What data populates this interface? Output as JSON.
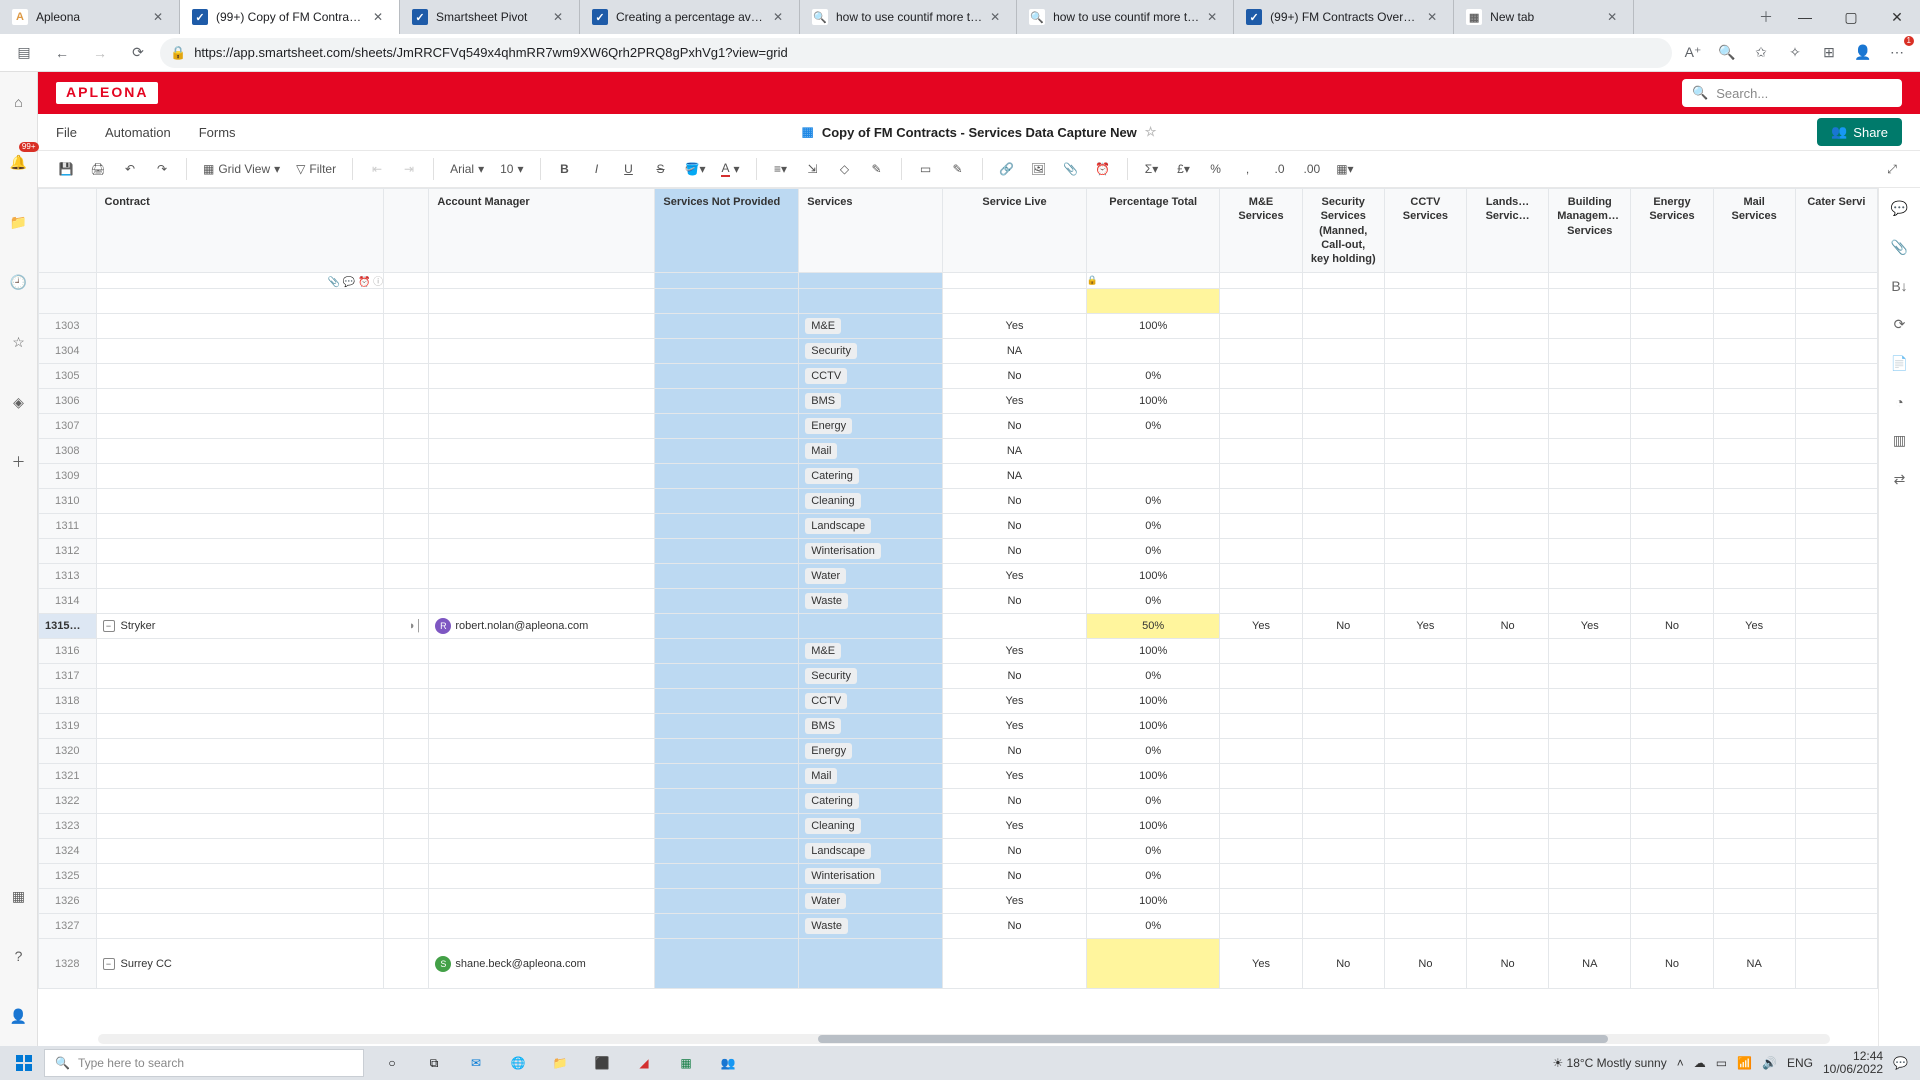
{
  "browser": {
    "tabs": [
      {
        "icon": "A",
        "iconbg": "#fff",
        "iconcolor": "#d94",
        "title": "Apleona",
        "active": false
      },
      {
        "icon": "✓",
        "iconbg": "#1e5ba8",
        "iconcolor": "#fff",
        "title": "(99+) Copy of FM Contract…",
        "active": true
      },
      {
        "icon": "✓",
        "iconbg": "#1e5ba8",
        "iconcolor": "#fff",
        "title": "Smartsheet Pivot",
        "active": false
      },
      {
        "icon": "✓",
        "iconbg": "#1e5ba8",
        "iconcolor": "#fff",
        "title": "Creating a percentage ave…",
        "active": false
      },
      {
        "icon": "🔍",
        "iconbg": "#fff",
        "iconcolor": "#666",
        "title": "how to use countif more t…",
        "active": false
      },
      {
        "icon": "🔍",
        "iconbg": "#fff",
        "iconcolor": "#666",
        "title": "how to use countif more t…",
        "active": false
      },
      {
        "icon": "✓",
        "iconbg": "#1e5ba8",
        "iconcolor": "#fff",
        "title": "(99+) FM Contracts Overv…",
        "active": false
      },
      {
        "icon": "▦",
        "iconbg": "#fff",
        "iconcolor": "#666",
        "title": "New tab",
        "active": false
      }
    ],
    "url": "https://app.smartsheet.com/sheets/JmRRCFVq549x4qhmRR7wm9XW6Qrh2PRQ8gPxhVg1?view=grid"
  },
  "app": {
    "logo": "APLEONA",
    "search_placeholder": "Search...",
    "menu": [
      "File",
      "Automation",
      "Forms"
    ],
    "doc_title": "Copy of FM Contracts - Services Data Capture New",
    "share_label": "Share",
    "toolbar": {
      "view": "Grid View",
      "filter": "Filter",
      "font": "Arial",
      "size": "10"
    }
  },
  "columns": [
    "Contract",
    "",
    "Account Manager",
    "Services Not Provided",
    "Services",
    "Service Live",
    "Percentage Total",
    "M&E Services",
    "Security Services (Manned, Call-out, key holding)",
    "CCTV Services",
    "Lands… Servic…",
    "Building Management Services",
    "Energy Services",
    "Mail Services",
    "Cater Servi"
  ],
  "rows": [
    {
      "n": 1303,
      "svc": "M&E",
      "live": "Yes",
      "pct": "100%"
    },
    {
      "n": 1304,
      "svc": "Security",
      "live": "NA",
      "pct": ""
    },
    {
      "n": 1305,
      "svc": "CCTV",
      "live": "No",
      "pct": "0%"
    },
    {
      "n": 1306,
      "svc": "BMS",
      "live": "Yes",
      "pct": "100%"
    },
    {
      "n": 1307,
      "svc": "Energy",
      "live": "No",
      "pct": "0%"
    },
    {
      "n": 1308,
      "svc": "Mail",
      "live": "NA",
      "pct": ""
    },
    {
      "n": 1309,
      "svc": "Catering",
      "live": "NA",
      "pct": ""
    },
    {
      "n": 1310,
      "svc": "Cleaning",
      "live": "No",
      "pct": "0%"
    },
    {
      "n": 1311,
      "svc": "Landscape",
      "live": "No",
      "pct": "0%"
    },
    {
      "n": 1312,
      "svc": "Winterisation",
      "live": "No",
      "pct": "0%"
    },
    {
      "n": 1313,
      "svc": "Water",
      "live": "Yes",
      "pct": "100%"
    },
    {
      "n": 1314,
      "svc": "Waste",
      "live": "No",
      "pct": "0%"
    },
    {
      "n": 1315,
      "contract": "Stryker",
      "am": "robert.nolan@apleona.com",
      "amc": "#7e57c2",
      "pct": "50%",
      "pcthl": true,
      "yn": [
        "Yes",
        "No",
        "Yes",
        "No",
        "Yes",
        "No",
        "Yes"
      ],
      "active": true,
      "expand": true
    },
    {
      "n": 1316,
      "svc": "M&E",
      "live": "Yes",
      "pct": "100%"
    },
    {
      "n": 1317,
      "svc": "Security",
      "live": "No",
      "pct": "0%"
    },
    {
      "n": 1318,
      "svc": "CCTV",
      "live": "Yes",
      "pct": "100%"
    },
    {
      "n": 1319,
      "svc": "BMS",
      "live": "Yes",
      "pct": "100%"
    },
    {
      "n": 1320,
      "svc": "Energy",
      "live": "No",
      "pct": "0%"
    },
    {
      "n": 1321,
      "svc": "Mail",
      "live": "Yes",
      "pct": "100%"
    },
    {
      "n": 1322,
      "svc": "Catering",
      "live": "No",
      "pct": "0%"
    },
    {
      "n": 1323,
      "svc": "Cleaning",
      "live": "Yes",
      "pct": "100%"
    },
    {
      "n": 1324,
      "svc": "Landscape",
      "live": "No",
      "pct": "0%"
    },
    {
      "n": 1325,
      "svc": "Winterisation",
      "live": "No",
      "pct": "0%"
    },
    {
      "n": 1326,
      "svc": "Water",
      "live": "Yes",
      "pct": "100%"
    },
    {
      "n": 1327,
      "svc": "Waste",
      "live": "No",
      "pct": "0%"
    },
    {
      "n": 1328,
      "contract": "Surrey CC",
      "am": "shane.beck@apleona.com",
      "amc": "#43a047",
      "pct": "",
      "pcthl": true,
      "big": true,
      "yn": [
        "Yes",
        "No",
        "No",
        "No",
        "NA",
        "No",
        "NA"
      ],
      "expand": true
    }
  ],
  "taskbar": {
    "search_placeholder": "Type here to search",
    "weather": "18°C  Mostly sunny",
    "time": "12:44",
    "date": "10/06/2022"
  }
}
